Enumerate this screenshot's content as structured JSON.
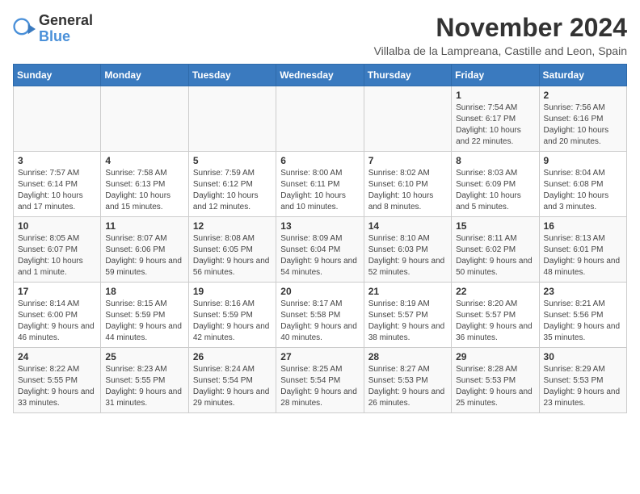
{
  "header": {
    "logo_general": "General",
    "logo_blue": "Blue",
    "title": "November 2024",
    "subtitle": "Villalba de la Lampreana, Castille and Leon, Spain"
  },
  "weekdays": [
    "Sunday",
    "Monday",
    "Tuesday",
    "Wednesday",
    "Thursday",
    "Friday",
    "Saturday"
  ],
  "weeks": [
    [
      {
        "day": "",
        "info": ""
      },
      {
        "day": "",
        "info": ""
      },
      {
        "day": "",
        "info": ""
      },
      {
        "day": "",
        "info": ""
      },
      {
        "day": "",
        "info": ""
      },
      {
        "day": "1",
        "info": "Sunrise: 7:54 AM\nSunset: 6:17 PM\nDaylight: 10 hours and 22 minutes."
      },
      {
        "day": "2",
        "info": "Sunrise: 7:56 AM\nSunset: 6:16 PM\nDaylight: 10 hours and 20 minutes."
      }
    ],
    [
      {
        "day": "3",
        "info": "Sunrise: 7:57 AM\nSunset: 6:14 PM\nDaylight: 10 hours and 17 minutes."
      },
      {
        "day": "4",
        "info": "Sunrise: 7:58 AM\nSunset: 6:13 PM\nDaylight: 10 hours and 15 minutes."
      },
      {
        "day": "5",
        "info": "Sunrise: 7:59 AM\nSunset: 6:12 PM\nDaylight: 10 hours and 12 minutes."
      },
      {
        "day": "6",
        "info": "Sunrise: 8:00 AM\nSunset: 6:11 PM\nDaylight: 10 hours and 10 minutes."
      },
      {
        "day": "7",
        "info": "Sunrise: 8:02 AM\nSunset: 6:10 PM\nDaylight: 10 hours and 8 minutes."
      },
      {
        "day": "8",
        "info": "Sunrise: 8:03 AM\nSunset: 6:09 PM\nDaylight: 10 hours and 5 minutes."
      },
      {
        "day": "9",
        "info": "Sunrise: 8:04 AM\nSunset: 6:08 PM\nDaylight: 10 hours and 3 minutes."
      }
    ],
    [
      {
        "day": "10",
        "info": "Sunrise: 8:05 AM\nSunset: 6:07 PM\nDaylight: 10 hours and 1 minute."
      },
      {
        "day": "11",
        "info": "Sunrise: 8:07 AM\nSunset: 6:06 PM\nDaylight: 9 hours and 59 minutes."
      },
      {
        "day": "12",
        "info": "Sunrise: 8:08 AM\nSunset: 6:05 PM\nDaylight: 9 hours and 56 minutes."
      },
      {
        "day": "13",
        "info": "Sunrise: 8:09 AM\nSunset: 6:04 PM\nDaylight: 9 hours and 54 minutes."
      },
      {
        "day": "14",
        "info": "Sunrise: 8:10 AM\nSunset: 6:03 PM\nDaylight: 9 hours and 52 minutes."
      },
      {
        "day": "15",
        "info": "Sunrise: 8:11 AM\nSunset: 6:02 PM\nDaylight: 9 hours and 50 minutes."
      },
      {
        "day": "16",
        "info": "Sunrise: 8:13 AM\nSunset: 6:01 PM\nDaylight: 9 hours and 48 minutes."
      }
    ],
    [
      {
        "day": "17",
        "info": "Sunrise: 8:14 AM\nSunset: 6:00 PM\nDaylight: 9 hours and 46 minutes."
      },
      {
        "day": "18",
        "info": "Sunrise: 8:15 AM\nSunset: 5:59 PM\nDaylight: 9 hours and 44 minutes."
      },
      {
        "day": "19",
        "info": "Sunrise: 8:16 AM\nSunset: 5:59 PM\nDaylight: 9 hours and 42 minutes."
      },
      {
        "day": "20",
        "info": "Sunrise: 8:17 AM\nSunset: 5:58 PM\nDaylight: 9 hours and 40 minutes."
      },
      {
        "day": "21",
        "info": "Sunrise: 8:19 AM\nSunset: 5:57 PM\nDaylight: 9 hours and 38 minutes."
      },
      {
        "day": "22",
        "info": "Sunrise: 8:20 AM\nSunset: 5:57 PM\nDaylight: 9 hours and 36 minutes."
      },
      {
        "day": "23",
        "info": "Sunrise: 8:21 AM\nSunset: 5:56 PM\nDaylight: 9 hours and 35 minutes."
      }
    ],
    [
      {
        "day": "24",
        "info": "Sunrise: 8:22 AM\nSunset: 5:55 PM\nDaylight: 9 hours and 33 minutes."
      },
      {
        "day": "25",
        "info": "Sunrise: 8:23 AM\nSunset: 5:55 PM\nDaylight: 9 hours and 31 minutes."
      },
      {
        "day": "26",
        "info": "Sunrise: 8:24 AM\nSunset: 5:54 PM\nDaylight: 9 hours and 29 minutes."
      },
      {
        "day": "27",
        "info": "Sunrise: 8:25 AM\nSunset: 5:54 PM\nDaylight: 9 hours and 28 minutes."
      },
      {
        "day": "28",
        "info": "Sunrise: 8:27 AM\nSunset: 5:53 PM\nDaylight: 9 hours and 26 minutes."
      },
      {
        "day": "29",
        "info": "Sunrise: 8:28 AM\nSunset: 5:53 PM\nDaylight: 9 hours and 25 minutes."
      },
      {
        "day": "30",
        "info": "Sunrise: 8:29 AM\nSunset: 5:53 PM\nDaylight: 9 hours and 23 minutes."
      }
    ]
  ]
}
